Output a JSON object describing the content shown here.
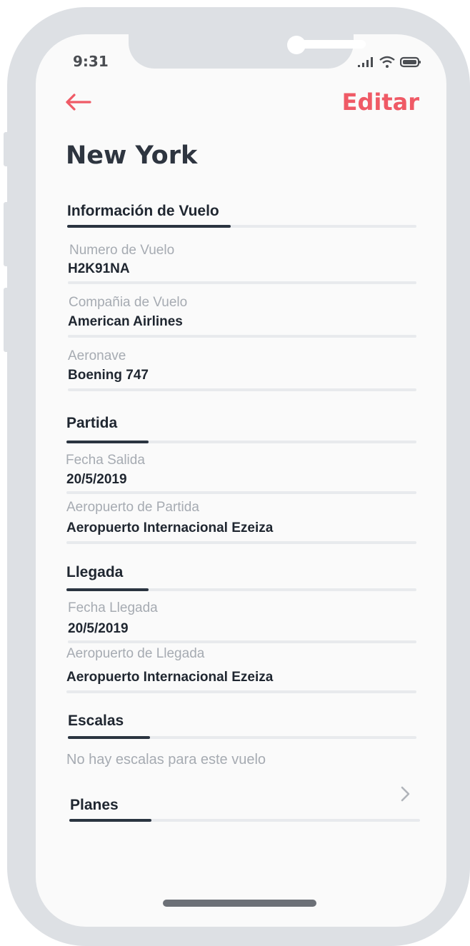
{
  "status_bar": {
    "time": "9:31"
  },
  "header": {
    "back_icon": "arrow-left-icon",
    "edit_label": "Editar",
    "accent_color": "#ef5a66"
  },
  "page": {
    "title": "New York"
  },
  "sections": {
    "flight_info": {
      "title": "Información de Vuelo",
      "fields": [
        {
          "label": "Numero de Vuelo",
          "value": "H2K91NA"
        },
        {
          "label": "Compañia de Vuelo",
          "value": "American Airlines"
        },
        {
          "label": "Aeronave",
          "value": "Boening 747"
        }
      ]
    },
    "departure": {
      "title": "Partida",
      "fields": [
        {
          "label": "Fecha Salida",
          "value": "20/5/2019"
        },
        {
          "label": "Aeropuerto de Partida",
          "value": "Aeropuerto Internacional Ezeiza"
        }
      ]
    },
    "arrival": {
      "title": "Llegada",
      "fields": [
        {
          "label": "Fecha Llegada",
          "value": "20/5/2019"
        },
        {
          "label": "Aeropuerto de Llegada",
          "value": "Aeropuerto Internacional Ezeiza"
        }
      ]
    },
    "stops": {
      "title": "Escalas",
      "empty_text": "No hay escalas para este vuelo"
    },
    "plans": {
      "title": "Planes",
      "chevron_icon": "chevron-right-icon"
    }
  }
}
